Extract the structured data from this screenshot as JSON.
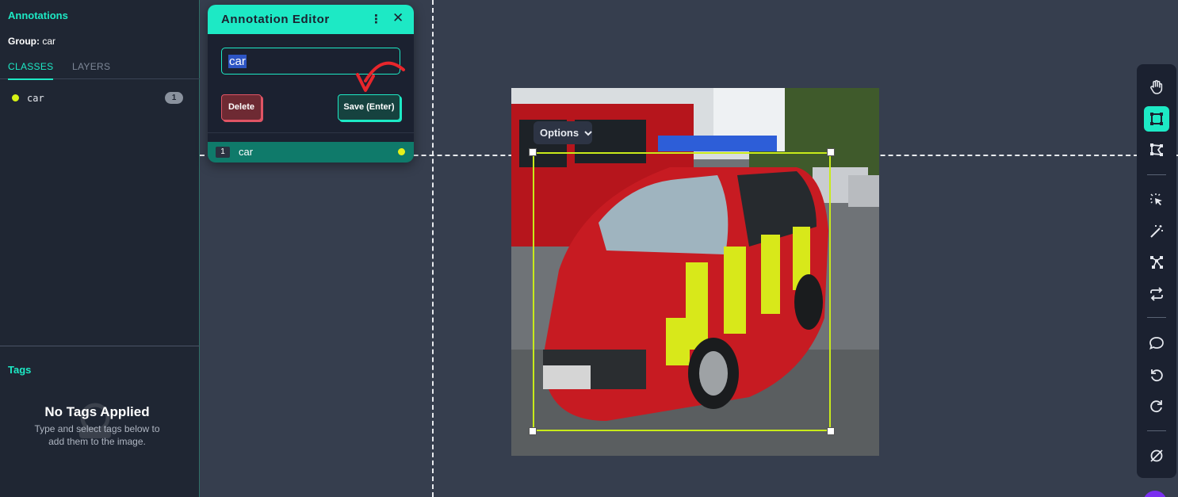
{
  "sidebar": {
    "title": "Annotations",
    "group_label": "Group:",
    "group_value": "car",
    "tabs": [
      {
        "label": "CLASSES",
        "active": true
      },
      {
        "label": "LAYERS",
        "active": false
      }
    ],
    "classes": [
      {
        "name": "car",
        "count": "1",
        "color": "#d7f215"
      }
    ],
    "tags_title": "Tags",
    "no_tags_title": "No Tags Applied",
    "no_tags_desc": "Type and select tags below to add them to the image."
  },
  "editor": {
    "title": "Annotation Editor",
    "input_value": "car",
    "delete_label": "Delete",
    "save_label": "Save (Enter)",
    "annotation": {
      "index": "1",
      "name": "car",
      "color": "#e6f01a"
    }
  },
  "canvas": {
    "options_label": "Options",
    "bbox_color": "#c8ea1a"
  },
  "toolbar": {
    "tools": [
      {
        "icon": "hand-icon",
        "active": false
      },
      {
        "icon": "bounding-box-icon",
        "active": true
      },
      {
        "icon": "polygon-icon",
        "active": false
      },
      {
        "icon": "smart-select-icon",
        "active": false
      },
      {
        "icon": "magic-wand-icon",
        "active": false
      },
      {
        "icon": "keypoints-icon",
        "active": false
      },
      {
        "icon": "repeat-icon",
        "active": false
      },
      {
        "icon": "comment-icon",
        "active": false
      },
      {
        "icon": "undo-icon",
        "active": false
      },
      {
        "icon": "redo-icon",
        "active": false
      },
      {
        "icon": "hide-icon",
        "active": false
      }
    ]
  },
  "colors": {
    "accent": "#1de9c5",
    "panel": "#1f2633",
    "canvas": "#363e4e"
  }
}
